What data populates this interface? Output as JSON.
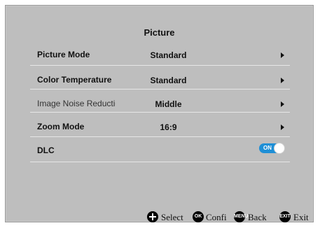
{
  "menu": {
    "title": "Picture",
    "rows": [
      {
        "label": "Picture Mode",
        "value": "Standard"
      },
      {
        "label": "Color Temperature",
        "value": "Standard"
      },
      {
        "label": "Image Noise Reductio",
        "value": "Middle"
      },
      {
        "label": "Zoom Mode",
        "value": "16:9"
      },
      {
        "label": "DLC",
        "toggle": "ON"
      }
    ]
  },
  "footer": {
    "select": "Select",
    "ok_icon": "OK",
    "confirm": "Confi",
    "menu_icon": "MENU",
    "back": "Back",
    "exit_icon": "EXIT",
    "exit": "Exit"
  },
  "icons": {
    "arrow": "play-right-icon",
    "dpad": "dpad-icon"
  },
  "colors": {
    "panel": "#bebebe",
    "toggle_on": "#1e8fd6"
  }
}
